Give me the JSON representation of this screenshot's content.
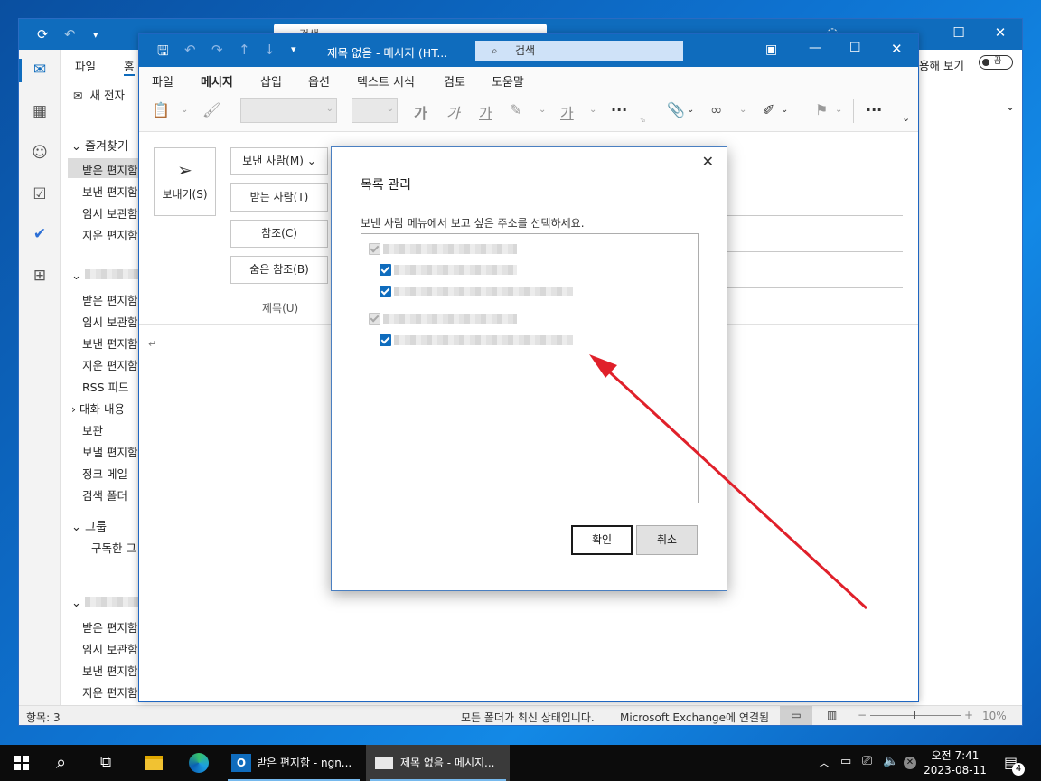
{
  "main_window": {
    "search_placeholder": "검색",
    "ribbon_tabs": [
      "파일",
      "홈"
    ],
    "new_mail_label": "새 전자",
    "focus_toggle_label": "용해 보기",
    "focus_toggle_state": "끔",
    "folders": {
      "favorites_header": "즐겨찾기",
      "favorites": [
        "받은 편지함",
        "보낸 편지함",
        "임시 보관함",
        "지운 편지함"
      ],
      "account1": [
        "받은 편지함",
        "임시 보관함",
        "보낸 편지함",
        "지운 편지함",
        "RSS 피드",
        "대화 내용",
        "보관",
        "보낼 편지함",
        "정크 메일",
        "검색 폴더"
      ],
      "groups_header": "그룹",
      "groups_sub": "구독한 그",
      "account2": [
        "받은 편지함",
        "임시 보관함",
        "보낸 편지함",
        "지운 편지함"
      ]
    },
    "status": {
      "items": "항목: 3",
      "sync": "모든 폴더가 최신 상태입니다.",
      "connection": "Microsoft Exchange에 연결됨",
      "zoom": "10%"
    }
  },
  "compose": {
    "title": "제목 없음  -  메시지 (HT...",
    "search_placeholder": "검색",
    "tabs": [
      "파일",
      "메시지",
      "삽입",
      "옵션",
      "텍스트 서식",
      "검토",
      "도움말"
    ],
    "active_tab": "메시지",
    "format_glyphs": [
      "가",
      "가",
      "가",
      "가"
    ],
    "send_label": "보내기(S)",
    "from_label": "보낸 사람(M)",
    "to_label": "받는 사람(T)",
    "cc_label": "참조(C)",
    "bcc_label": "숨은 참조(B)",
    "subject_label": "제목(U)",
    "body_mark": "↵"
  },
  "dialog": {
    "title": "목록 관리",
    "description": "보낸 사람 메뉴에서 보고 싶은 주소를 선택하세요.",
    "ok_label": "확인",
    "cancel_label": "취소",
    "groups": [
      {
        "checked": true,
        "disabled": true,
        "entries": [
          {
            "checked": true
          },
          {
            "checked": true
          }
        ]
      },
      {
        "checked": true,
        "disabled": true,
        "entries": [
          {
            "checked": true
          }
        ]
      }
    ]
  },
  "annotation": {
    "arrow_color": "#e0202a"
  },
  "taskbar": {
    "apps": [
      {
        "name": "start",
        "label": ""
      },
      {
        "name": "search",
        "label": ""
      },
      {
        "name": "task-view",
        "label": ""
      },
      {
        "name": "file-explorer",
        "label": ""
      },
      {
        "name": "edge",
        "label": ""
      },
      {
        "name": "outlook-inbox",
        "label": "받은 편지함 - ngn..."
      },
      {
        "name": "outlook-compose",
        "label": "제목 없음 - 메시지..."
      }
    ],
    "time": "오전 7:41",
    "date": "2023-08-11",
    "notification_count": "4"
  },
  "colors": {
    "accent": "#0f6cbd",
    "taskbar": "#0c0c0c"
  }
}
